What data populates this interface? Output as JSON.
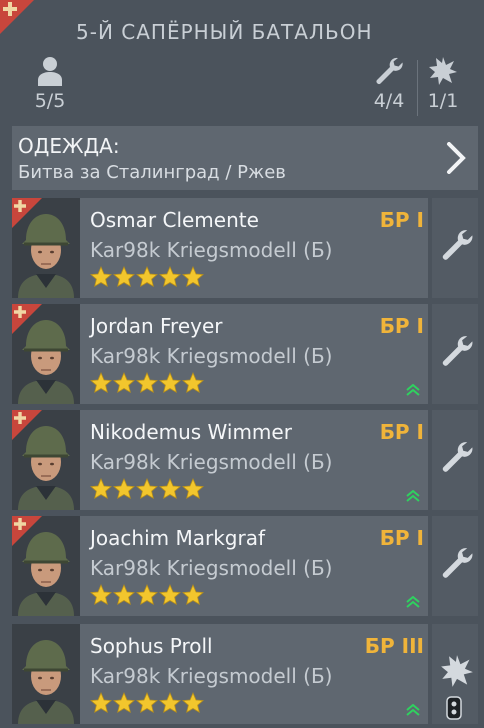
{
  "header": {
    "title": "5-Й САПЁРНЫЙ БАТАЛЬОН",
    "soldiers_count": "5/5",
    "engineers_count": "4/4",
    "explosives_count": "1/1"
  },
  "outfit": {
    "label": "ОДЕЖДА:",
    "value": "Битва за Сталинград / Ржев"
  },
  "soldiers": [
    {
      "name": "Osmar Clemente",
      "weapon": "Kar98k Kriegsmodell (Б)",
      "rank": "БР I",
      "stars": 5,
      "role_icon": "wrench-icon",
      "has_upgrade": false,
      "has_flag": true
    },
    {
      "name": "Jordan Freyer",
      "weapon": "Kar98k Kriegsmodell (Б)",
      "rank": "БР I",
      "stars": 5,
      "role_icon": "wrench-icon",
      "has_upgrade": true,
      "has_flag": true
    },
    {
      "name": "Nikodemus Wimmer",
      "weapon": "Kar98k Kriegsmodell (Б)",
      "rank": "БР I",
      "stars": 5,
      "role_icon": "wrench-icon",
      "has_upgrade": true,
      "has_flag": true
    },
    {
      "name": "Joachim Markgraf",
      "weapon": "Kar98k Kriegsmodell (Б)",
      "rank": "БР I",
      "stars": 5,
      "role_icon": "wrench-icon",
      "has_upgrade": true,
      "has_flag": true
    },
    {
      "name": "Sophus Proll",
      "weapon": "Kar98k Kriegsmodell (Б)",
      "rank": "БР III",
      "stars": 5,
      "role_icon": "explosion-icon",
      "has_upgrade": true,
      "has_flag": false
    }
  ],
  "colors": {
    "background": "#4b535c",
    "card": "#5f6770",
    "rank": "#f0b43a",
    "flag": "#c8463c",
    "star": "#f2c62d",
    "upgrade": "#2fd15f"
  }
}
